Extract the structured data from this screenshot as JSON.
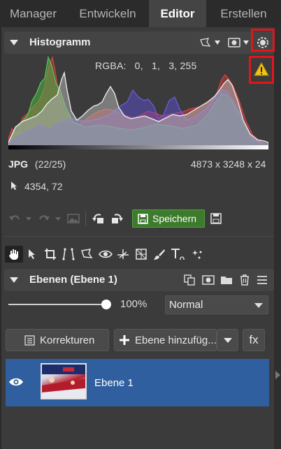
{
  "tabs": [
    {
      "label": "Manager"
    },
    {
      "label": "Entwickeln"
    },
    {
      "label": "Editor"
    },
    {
      "label": "Erstellen"
    }
  ],
  "histogram": {
    "title": "Histogramm",
    "rgba_label": "RGBA:",
    "rgba_values": "0,   1,   3, 255",
    "colors": {
      "red": "#c93a3a",
      "green": "#4db848",
      "blue": "#5b4fd0",
      "white": "#e0e0e0"
    }
  },
  "file_info": {
    "format": "JPG",
    "counter": "(22/25)",
    "dimensions": "4873 x 3248 x 24",
    "cursor_pos": "4354, 72"
  },
  "toolbar": {
    "save_label": "Speichern"
  },
  "layers": {
    "title": "Ebenen (Ebene 1)",
    "opacity": "100%",
    "blend_mode": "Normal",
    "corrections_label": "Korrekturen",
    "add_layer_label": "Ebene hinzufüg...",
    "fx_label": "fx",
    "items": [
      {
        "name": "Ebene 1",
        "visible": true,
        "selected": true
      }
    ]
  },
  "accent": {
    "highlight_red": "#e0161d",
    "selection_blue": "#2f5f9e",
    "save_green": "#3c7a2c"
  }
}
